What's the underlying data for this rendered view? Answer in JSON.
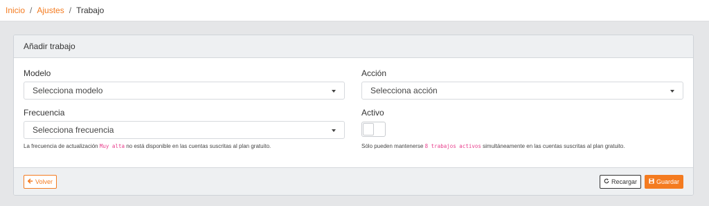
{
  "breadcrumb": {
    "items": [
      "Inicio",
      "Ajustes"
    ],
    "separator": "/",
    "current": "Trabajo"
  },
  "card": {
    "title": "Añadir trabajo"
  },
  "form": {
    "modelo": {
      "label": "Modelo",
      "placeholder": "Selecciona modelo"
    },
    "accion": {
      "label": "Acción",
      "placeholder": "Selecciona acción"
    },
    "frecuencia": {
      "label": "Frecuencia",
      "placeholder": "Selecciona frecuencia",
      "help_before": "La frecuencia de actualización",
      "help_code": "Muy alta",
      "help_after": "no está disponible en las cuentas suscritas al plan gratuito."
    },
    "activo": {
      "label": "Activo",
      "value": false,
      "help_before": "Sólo pueden mantenerse",
      "help_code": "8 trabajos activos",
      "help_after": "simultáneamente en las cuentas suscritas al plan gratuito."
    }
  },
  "footer": {
    "back_label": "Volver",
    "reload_label": "Recargar",
    "save_label": "Guardar"
  },
  "icons": {
    "back": "arrow-left-icon",
    "reload": "refresh-icon",
    "save": "floppy-disk-icon",
    "dropdown": "caret-down-icon"
  },
  "colors": {
    "accent": "#f47b20",
    "code": "#e83e8c"
  }
}
